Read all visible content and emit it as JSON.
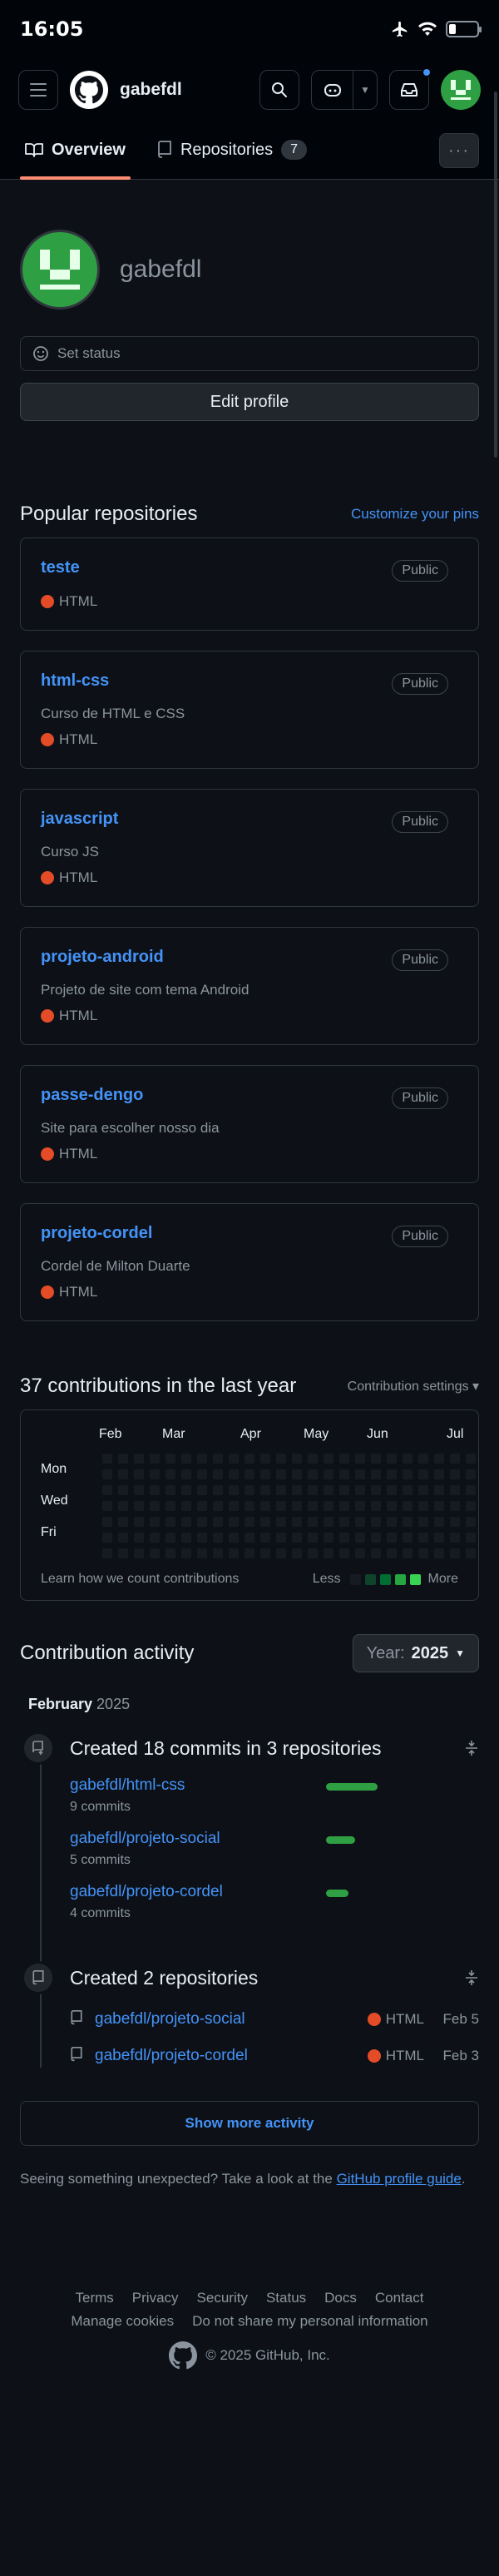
{
  "status_bar": {
    "time": "16:05",
    "battery_level": 0.25
  },
  "header": {
    "username": "gabefdl"
  },
  "tabs": [
    {
      "label": "Overview"
    },
    {
      "label": "Repositories",
      "count": "7"
    }
  ],
  "profile": {
    "name": "gabefdl",
    "set_status": "Set status",
    "edit_profile": "Edit profile"
  },
  "popular": {
    "title": "Popular repositories",
    "customize": "Customize your pins",
    "repos": [
      {
        "name": "teste",
        "visibility": "Public",
        "description": "",
        "language": "HTML"
      },
      {
        "name": "html-css",
        "visibility": "Public",
        "description": "Curso de HTML e CSS",
        "language": "HTML"
      },
      {
        "name": "javascript",
        "visibility": "Public",
        "description": "Curso JS",
        "language": "HTML"
      },
      {
        "name": "projeto-android",
        "visibility": "Public",
        "description": "Projeto de site com tema Android",
        "language": "HTML"
      },
      {
        "name": "passe-dengo",
        "visibility": "Public",
        "description": "Site para escolher nosso dia",
        "language": "HTML"
      },
      {
        "name": "projeto-cordel",
        "visibility": "Public",
        "description": "Cordel de Milton Duarte",
        "language": "HTML"
      }
    ],
    "language_color": "#e34c26"
  },
  "contributions": {
    "title": "37 contributions in the last year",
    "settings": "Contribution settings",
    "months": [
      "Feb",
      "Mar",
      "Apr",
      "May",
      "Jun",
      "Jul"
    ],
    "days": [
      "Mon",
      "Wed",
      "Fri"
    ],
    "learn": "Learn how we count contributions",
    "less": "Less",
    "more": "More",
    "legend_colors": [
      "#161b22",
      "#0e4429",
      "#006d32",
      "#26a641",
      "#39d353"
    ]
  },
  "activity": {
    "title": "Contribution activity",
    "year_label": "Year:",
    "year": "2025",
    "month": "February",
    "month_year": "2025",
    "commits_title": "Created 18 commits in 3 repositories",
    "commit_repos": [
      {
        "name": "gabefdl/html-css",
        "commits": "9 commits",
        "share": 0.5
      },
      {
        "name": "gabefdl/projeto-social",
        "commits": "5 commits",
        "share": 0.28
      },
      {
        "name": "gabefdl/projeto-cordel",
        "commits": "4 commits",
        "share": 0.22
      }
    ],
    "repos_title": "Created 2 repositories",
    "created_repos": [
      {
        "name": "gabefdl/projeto-social",
        "language": "HTML",
        "date": "Feb 5"
      },
      {
        "name": "gabefdl/projeto-cordel",
        "language": "HTML",
        "date": "Feb 3"
      }
    ],
    "show_more": "Show more activity",
    "unexpected_text": "Seeing something unexpected? Take a look at the ",
    "unexpected_link": "GitHub profile guide",
    "unexpected_end": "."
  },
  "footer": {
    "links": [
      "Terms",
      "Privacy",
      "Security",
      "Status",
      "Docs",
      "Contact",
      "Manage cookies",
      "Do not share my personal information"
    ],
    "copyright": "© 2025 GitHub, Inc."
  }
}
